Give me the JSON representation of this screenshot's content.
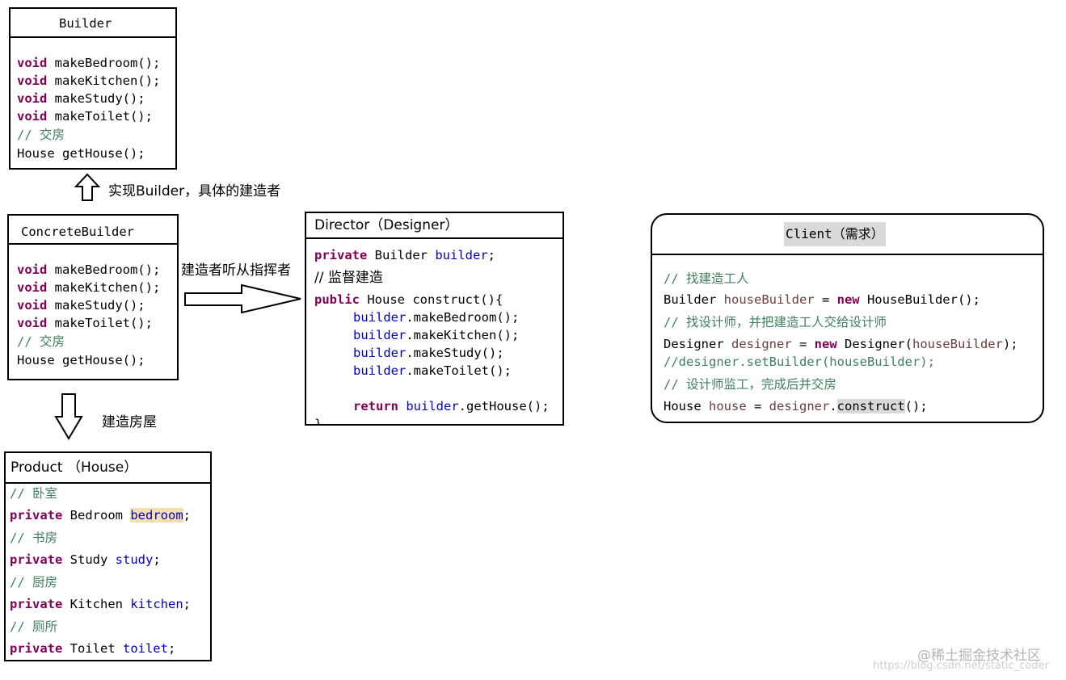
{
  "builder": {
    "title": "Builder",
    "lines": [
      {
        "kw": "void",
        "rest": " makeBedroom();"
      },
      {
        "kw": "void",
        "rest": " makeKitchen();"
      },
      {
        "kw": "void",
        "rest": " makeStudy();"
      },
      {
        "kw": "void",
        "rest": " makeToilet();"
      }
    ],
    "comment": "// 交房",
    "last": "House getHouse();"
  },
  "implement_label": "实现Builder，具体的建造者",
  "concrete": {
    "title": "ConcreteBuilder",
    "lines": [
      {
        "kw": "void",
        "rest": " makeBedroom();"
      },
      {
        "kw": "void",
        "rest": " makeKitchen();"
      },
      {
        "kw": "void",
        "rest": " makeStudy();"
      },
      {
        "kw": "void",
        "rest": " makeToilet();"
      }
    ],
    "comment": "// 交房",
    "last": "House getHouse();"
  },
  "obey_label": "建造者听从指挥者",
  "build_label": "建造房屋",
  "director": {
    "title": "Director（Designer）",
    "field_kw": "private",
    "field_type": " Builder ",
    "field_name": "builder",
    "field_end": ";",
    "supervise": "// 监督建造",
    "method_kw": "public",
    "method_sig": " House construct(){",
    "calls": [
      "makeBedroom();",
      "makeKitchen();",
      "makeStudy();",
      "makeToilet();"
    ],
    "call_obj": "builder",
    "return_kw": "return",
    "return_obj": "builder",
    "return_rest": ".getHouse();",
    "closing": "}"
  },
  "client": {
    "title": "Client（需求）",
    "c1": "// 找建造工人",
    "l1_type": "Builder ",
    "l1_var": "houseBuilder",
    "l1_eq": " = ",
    "l1_kw": "new",
    "l1_rest": " HouseBuilder();",
    "c2": "// 找设计师，并把建造工人交给设计师",
    "l2_type": "Designer ",
    "l2_var": "designer",
    "l2_eq": " = ",
    "l2_kw": "new",
    "l2_rest1": " Designer(",
    "l2_arg": "houseBuilder",
    "l2_rest2": ");",
    "l3": "//designer.setBuilder(houseBuilder);",
    "c3": "// 设计师监工，完成后并交房",
    "l4_type": "House ",
    "l4_var": "house",
    "l4_eq": " = ",
    "l4_obj": "designer",
    "l4_dot": ".",
    "l4_call": "construct",
    "l4_end": "();"
  },
  "product": {
    "title": "Product （House）",
    "items": [
      {
        "comment": "// 卧室",
        "kw": "private",
        "type": " Bedroom ",
        "name": "bedroom",
        "end": ";"
      },
      {
        "comment": "// 书房",
        "kw": "private",
        "type": " Study ",
        "name": "study",
        "end": ";"
      },
      {
        "comment": "// 厨房",
        "kw": "private",
        "type": " Kitchen ",
        "name": "kitchen",
        "end": ";"
      },
      {
        "comment": "// 厕所",
        "kw": "private",
        "type": " Toilet ",
        "name": "toilet",
        "end": ";"
      }
    ]
  },
  "watermark": {
    "line1": "@稀土掘金技术社区",
    "line2": "https://blog.csdn.net/static_coder"
  },
  "colors": {
    "keyword": "#7f0055",
    "field": "#0000c0",
    "comment": "#3f7f5f",
    "local_var": "#6a3e3e",
    "highlight": "#f5dfb0",
    "client_title_bg": "#d9d9d9"
  }
}
